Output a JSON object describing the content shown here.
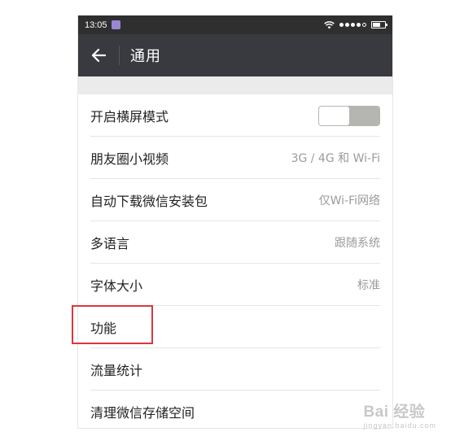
{
  "statusbar": {
    "time": "13:05"
  },
  "titlebar": {
    "title": "通用"
  },
  "settings": {
    "items": [
      {
        "label": "开启横屏模式"
      },
      {
        "label": "朋友圈小视频",
        "value": "3G / 4G 和 Wi-Fi"
      },
      {
        "label": "自动下载微信安装包",
        "value": "仅Wi-Fi网络"
      },
      {
        "label": "多语言",
        "value": "跟随系统"
      },
      {
        "label": "字体大小",
        "value": "标准"
      },
      {
        "label": "功能"
      },
      {
        "label": "流量统计"
      },
      {
        "label": "清理微信存储空间"
      }
    ],
    "landscape_toggle_on": false
  },
  "watermark": {
    "brand": "Bai 经验",
    "url": "jingyan.baidu.com"
  },
  "colors": {
    "titlebar": "#393a3f",
    "statusbar": "#2f2f2f",
    "highlight": "#d9383c",
    "toggle_off": "#b5b6b1"
  }
}
